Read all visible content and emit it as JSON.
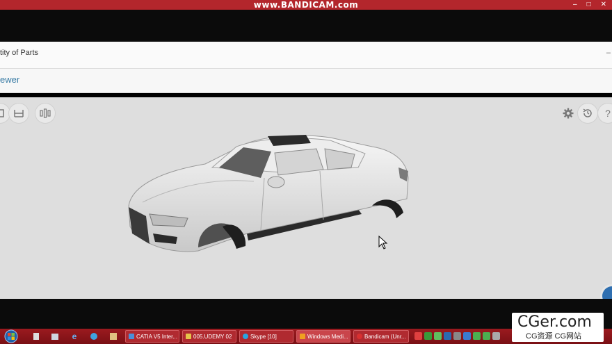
{
  "watermark": "www.BANDICAM.com",
  "window_controls": [
    "–",
    "□",
    "✕"
  ],
  "header": {
    "title": "tity of Parts",
    "collapse_label": "–"
  },
  "viewer": {
    "tab_label": "ewer"
  },
  "toolbar_left": [
    "fit-all",
    "ruler",
    "explode"
  ],
  "toolbar_right": [
    "settings",
    "reset-view",
    "help"
  ],
  "help_label": "?",
  "taskbar": {
    "buttons": [
      {
        "label": "CATIA V5 Inter...",
        "color": "#4a90d9"
      },
      {
        "label": "005.UDEMY 02",
        "color": "#e6c34a"
      },
      {
        "label": "Skype [10]",
        "color": "#2aa5e0"
      },
      {
        "label": "Windows Medi...",
        "color": "#f0a020"
      },
      {
        "label": "Bandicam (Unr...",
        "color": "#d83030"
      }
    ]
  },
  "watermark_box": {
    "big": "CGer.com",
    "small": "CG资源 CG网站"
  }
}
